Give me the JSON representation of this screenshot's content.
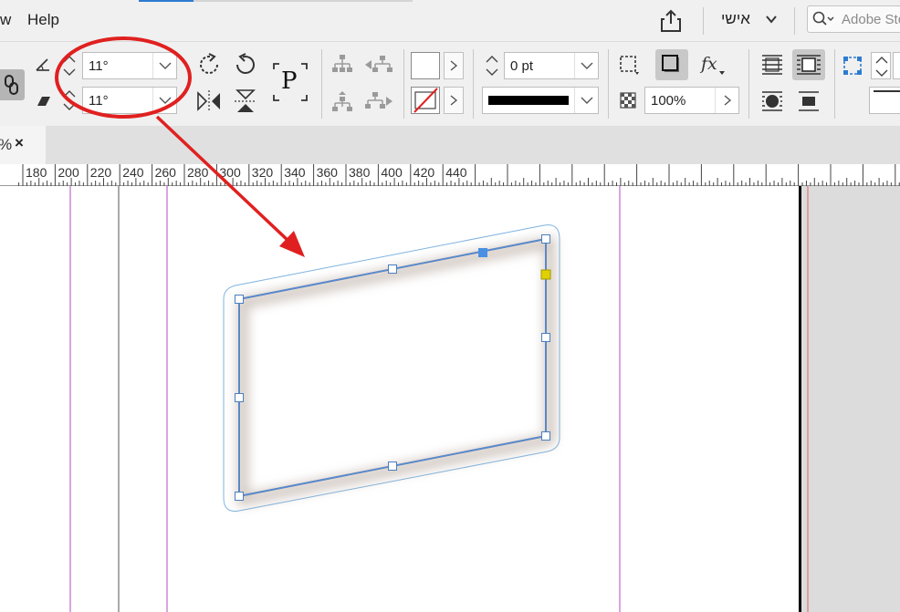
{
  "menu": {
    "partial_item": "w",
    "help": "Help"
  },
  "workspace": {
    "label": "אישי"
  },
  "stock_search": {
    "placeholder": "Adobe Sto"
  },
  "control_panel": {
    "shear_angle": "11°",
    "rotation_angle": "11°",
    "stroke_weight": "0 pt",
    "opacity": "100%",
    "paragraph_glyph": "P"
  },
  "document_tab": {
    "zoom_fragment": "%",
    "close_glyph": "×"
  },
  "ruler": {
    "labels": [
      "180",
      "200",
      "220",
      "240",
      "260",
      "280",
      "300",
      "320",
      "340",
      "360",
      "380",
      "400",
      "420",
      "440"
    ]
  },
  "annotation": {
    "color": "#e02020"
  },
  "colors": {
    "selection": "#4a90e2",
    "margin_guide": "#b04dc4",
    "bleed_guide": "#e06060",
    "page_edge": "#000000",
    "reference_point": "#e0d000"
  }
}
